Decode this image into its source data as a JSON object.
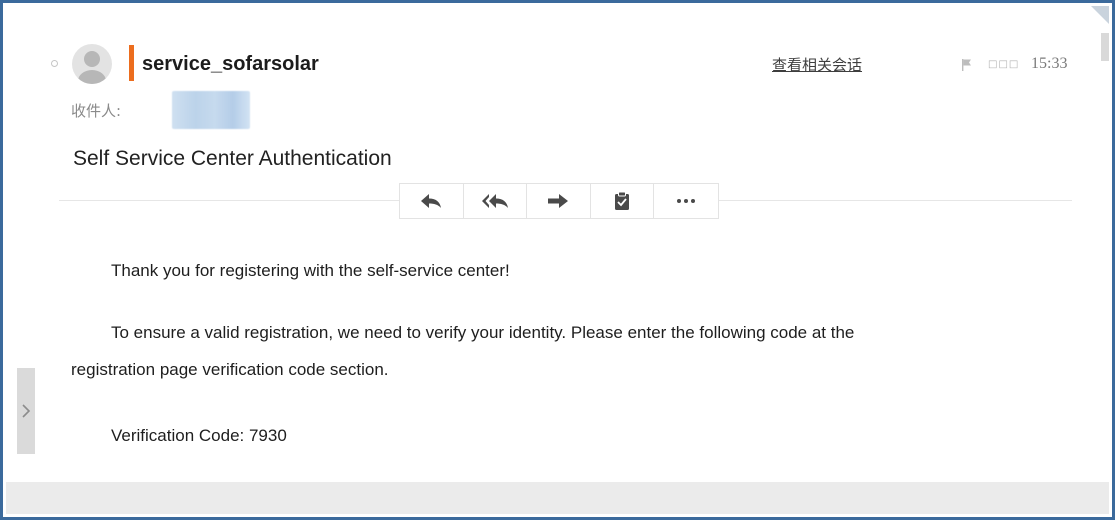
{
  "email": {
    "sender_name": "service_sofarsolar",
    "view_related_conversation": "查看相关会话",
    "status_boxes": "□□□",
    "time": "15:33",
    "recipient_label": "收件人:",
    "subject": "Self Service Center Authentication",
    "body": {
      "paragraph1": "Thank you for registering with the self-service center!",
      "paragraph2_line1": "To ensure a valid registration, we need to verify your identity. Please enter the following code at the",
      "paragraph2_line2": "registration page verification code section.",
      "code_label": "Verification Code: ",
      "code_value": "7930"
    }
  },
  "toolbar": {
    "buttons": [
      "reply-icon",
      "reply-all-icon",
      "forward-icon",
      "clipboard-icon",
      "more-icon"
    ]
  },
  "colors": {
    "frame_border": "#3b6a9c",
    "sender_accent": "#ec6d1e",
    "toolbar_icon": "#4a4a4a",
    "footer_bar": "#ebebeb"
  },
  "icons": {
    "side_tab": "chevron-right-icon",
    "flag": "flag-icon",
    "avatar": "user-avatar-icon"
  }
}
